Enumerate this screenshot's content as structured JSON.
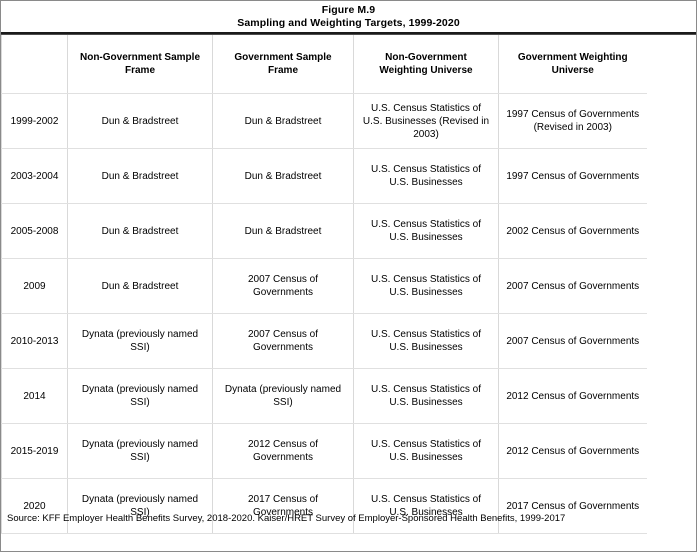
{
  "title": {
    "line1": "Figure M.9",
    "line2": "Sampling and Weighting Targets, 1999-2020"
  },
  "table": {
    "headers": [
      "",
      "Non-Government Sample Frame",
      "Government Sample Frame",
      "Non-Government Weighting Universe",
      "Government Weighting Universe"
    ],
    "rows": [
      {
        "year": "1999-2002",
        "nongov_sample_frame": "Dun & Bradstreet",
        "gov_sample_frame": "Dun & Bradstreet",
        "nongov_weighting_universe": "U.S. Census Statistics of U.S. Businesses (Revised in 2003)",
        "gov_weighting_universe": "1997 Census of Governments (Revised in 2003)"
      },
      {
        "year": "2003-2004",
        "nongov_sample_frame": "Dun & Bradstreet",
        "gov_sample_frame": "Dun & Bradstreet",
        "nongov_weighting_universe": "U.S. Census Statistics of U.S. Businesses",
        "gov_weighting_universe": "1997 Census of Governments"
      },
      {
        "year": "2005-2008",
        "nongov_sample_frame": "Dun & Bradstreet",
        "gov_sample_frame": "Dun & Bradstreet",
        "nongov_weighting_universe": "U.S. Census Statistics of U.S. Businesses",
        "gov_weighting_universe": "2002 Census of Governments"
      },
      {
        "year": "2009",
        "nongov_sample_frame": "Dun & Bradstreet",
        "gov_sample_frame": "2007 Census of Governments",
        "nongov_weighting_universe": "U.S. Census Statistics of U.S. Businesses",
        "gov_weighting_universe": "2007 Census of Governments"
      },
      {
        "year": "2010-2013",
        "nongov_sample_frame": "Dynata (previously named SSI)",
        "gov_sample_frame": "2007 Census of Governments",
        "nongov_weighting_universe": "U.S. Census Statistics of U.S. Businesses",
        "gov_weighting_universe": "2007 Census of Governments"
      },
      {
        "year": "2014",
        "nongov_sample_frame": "Dynata (previously named SSI)",
        "gov_sample_frame": "Dynata (previously named SSI)",
        "nongov_weighting_universe": "U.S. Census Statistics of U.S. Businesses",
        "gov_weighting_universe": "2012 Census of Governments"
      },
      {
        "year": "2015-2019",
        "nongov_sample_frame": "Dynata (previously named SSI)",
        "gov_sample_frame": "2012 Census of Governments",
        "nongov_weighting_universe": "U.S. Census Statistics of U.S. Businesses",
        "gov_weighting_universe": "2012 Census of Governments"
      },
      {
        "year": "2020",
        "nongov_sample_frame": "Dynata (previously named SSI)",
        "gov_sample_frame": "2017 Census of Governments",
        "nongov_weighting_universe": "U.S. Census Statistics of U.S. Businesses",
        "gov_weighting_universe": "2017 Census of Governments"
      }
    ]
  },
  "source": "Source: KFF Employer Health Benefits Survey, 2018-2020. Kaiser/HRET Survey of Employer-Sponsored Health Benefits, 1999-2017"
}
